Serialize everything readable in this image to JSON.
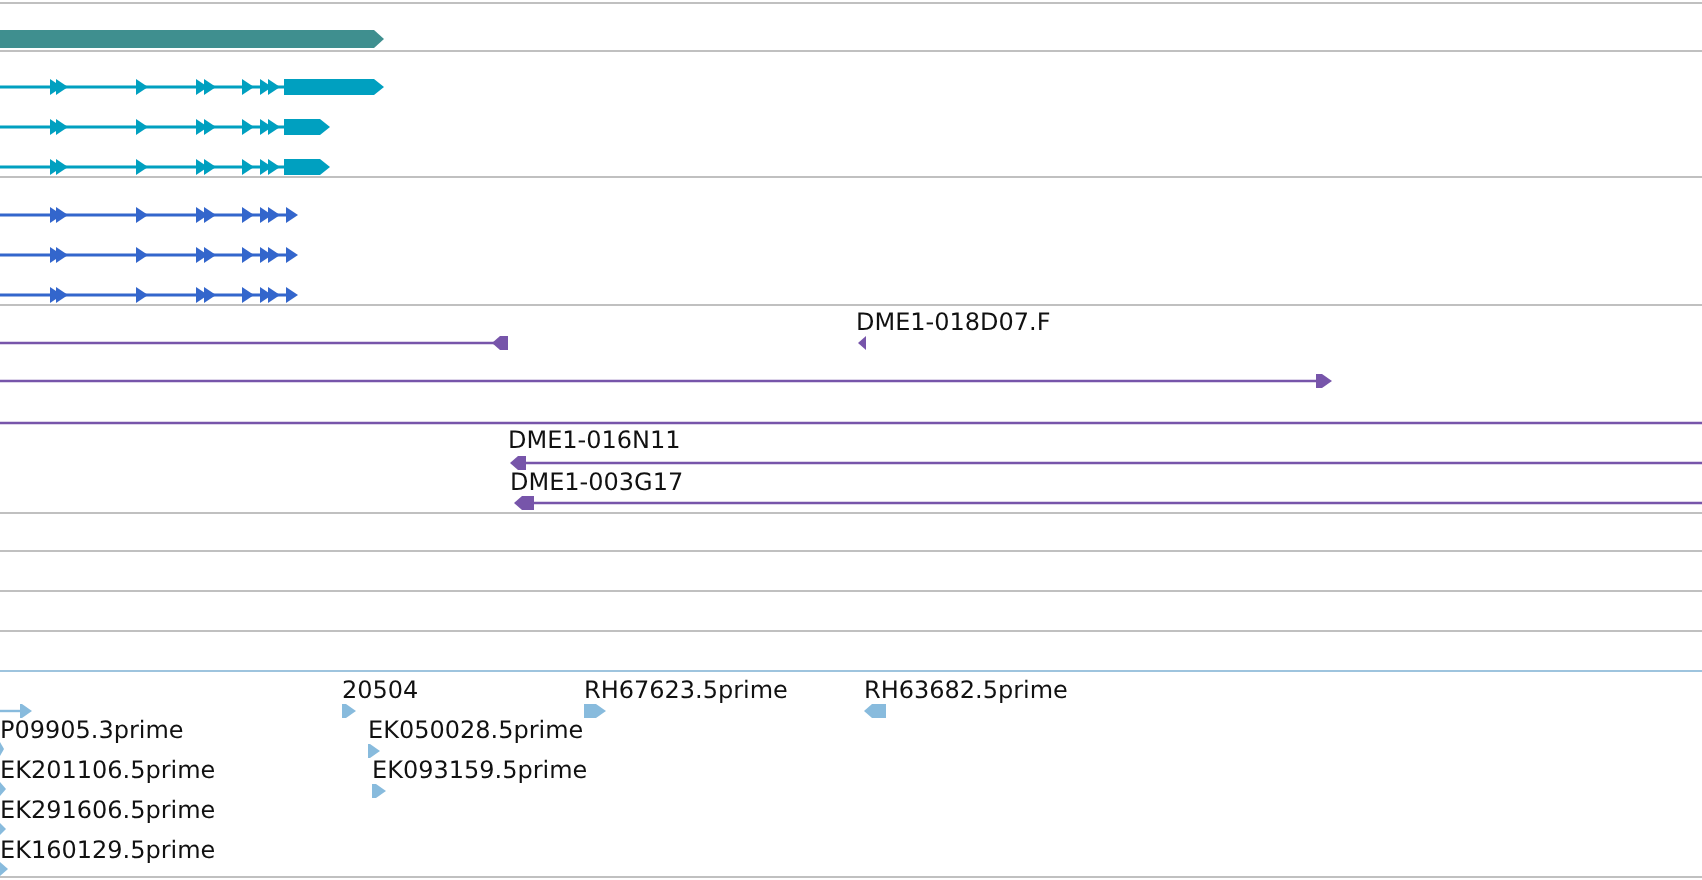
{
  "tracks": [
    {
      "kind": "gene",
      "color": "#3f8f8f",
      "features": [
        {
          "reverse": false
        }
      ]
    },
    {
      "kind": "transcript",
      "color": "#00a0c0",
      "features": [
        {
          "reverse": false
        },
        {
          "reverse": false
        },
        {
          "reverse": false
        }
      ]
    },
    {
      "kind": "transcript",
      "color": "#3366cc",
      "features": [
        {
          "reverse": false
        },
        {
          "reverse": false
        },
        {
          "reverse": false
        }
      ]
    },
    {
      "kind": "match",
      "color": "#7755aa",
      "features": [
        {
          "reverse": true
        },
        {
          "label": "DME1-018D07.F",
          "reverse": true
        },
        {
          "reverse": false
        },
        {
          "kind": "span"
        },
        {
          "label": "DME1-016N11",
          "reverse": true
        },
        {
          "label": "DME1-003G17",
          "reverse": true
        }
      ]
    },
    {
      "kind": "est",
      "color": "#88bbdd",
      "features": [
        {
          "reverse": false
        },
        {
          "label": "P09905.3prime",
          "reverse": false
        },
        {
          "label": "EK201106.5prime",
          "reverse": false
        },
        {
          "label": "EK291606.5prime",
          "reverse": false
        },
        {
          "label": "EK160129.5prime",
          "reverse": false
        },
        {
          "label": "20504",
          "reverse": false
        },
        {
          "label": "EK050028.5prime",
          "reverse": false
        },
        {
          "label": "EK093159.5prime",
          "reverse": false
        },
        {
          "label": "RH67623.5prime",
          "reverse": false
        },
        {
          "label": "RH63682.5prime",
          "reverse": true
        }
      ]
    }
  ]
}
